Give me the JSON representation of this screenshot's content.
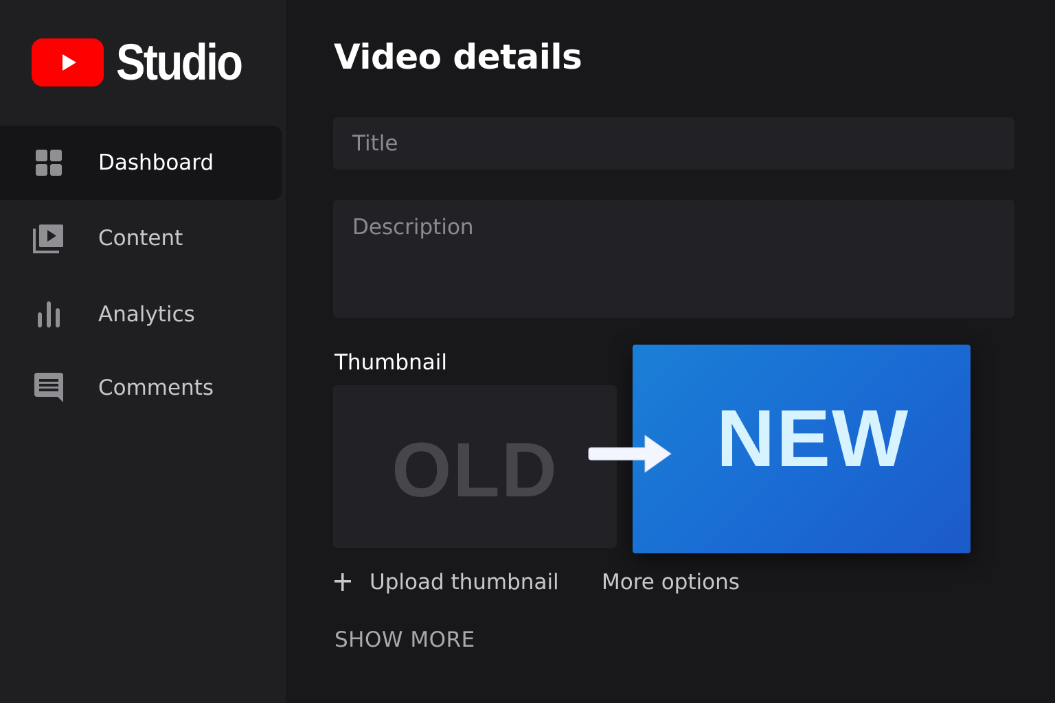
{
  "brand": {
    "logo_text": "Studio",
    "badge_color": "#ff0000"
  },
  "sidebar": {
    "items": [
      {
        "label": "Dashboard",
        "icon": "dashboard-grid-icon",
        "active": true
      },
      {
        "label": "Content",
        "icon": "video-library-icon",
        "active": false
      },
      {
        "label": "Analytics",
        "icon": "bar-chart-icon",
        "active": false
      },
      {
        "label": "Comments",
        "icon": "comment-icon",
        "active": false
      }
    ]
  },
  "main": {
    "title": "Video details",
    "title_field": {
      "placeholder": "Title"
    },
    "description_field": {
      "placeholder": "Description"
    },
    "thumbnail": {
      "label": "Thumbnail",
      "old_text": "OLD",
      "new_text": "NEW",
      "new_color": "#1a6bd4"
    },
    "upload_label": "Upload thumbnail",
    "more_options_label": "More options",
    "show_more_label": "SHOW MORE"
  }
}
